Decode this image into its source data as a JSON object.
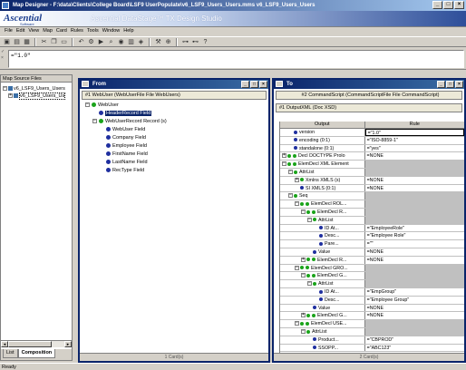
{
  "window": {
    "title": "Map Designer - F:\\data\\Clients\\College Board\\LSF9 UserPopulate\\v6_LSF9_Users_Users.mms v6_LSF9_Users_Users",
    "min": "_",
    "max": "□",
    "close": "×"
  },
  "banner": {
    "logo": "Ascential",
    "logo_sub": "Software",
    "studio": "Ascential DataStage™ TX Design Studio"
  },
  "menu": [
    "File",
    "Edit",
    "View",
    "Map",
    "Card",
    "Rules",
    "Tools",
    "Window",
    "Help"
  ],
  "toolbar_icons": [
    "new-icon",
    "open-icon",
    "save-icon",
    "cut-icon",
    "copy-icon",
    "paste-icon",
    "undo-icon",
    "build-icon",
    "run-icon",
    "find-icon",
    "trace-icon",
    "cards-icon",
    "compose-icon",
    "tool-icon",
    "zoom-icon",
    "help-icon"
  ],
  "rule_bar": {
    "value": "=\"1.0\""
  },
  "left_pane": {
    "header": "Map Source Files",
    "items": [
      {
        "label": "v6_LSF9_Users_Users",
        "level": 0
      },
      {
        "label": "v6_LSF9_Users_Us",
        "level": 1
      }
    ],
    "tabs": [
      {
        "label": "List",
        "active": false
      },
      {
        "label": "Composition",
        "active": true
      }
    ]
  },
  "from_pane": {
    "title": "From",
    "card_header": "#1 WebUser (WebUserFile File WebUsers)",
    "footer": "1 Card(s)",
    "nodes": [
      {
        "label": "WebUser",
        "level": 0,
        "expander": "−",
        "dot": "green",
        "selected": false
      },
      {
        "label": "HeaderRecord Field",
        "level": 1,
        "expander": "",
        "dot": "blue",
        "selected": true
      },
      {
        "label": "WebUserRecord Record (s)",
        "level": 1,
        "expander": "−",
        "dot": "green",
        "selected": false
      },
      {
        "label": "WebUser Field",
        "level": 2,
        "expander": "",
        "dot": "blue",
        "selected": false
      },
      {
        "label": "Company Field",
        "level": 2,
        "expander": "",
        "dot": "blue",
        "selected": false
      },
      {
        "label": "Employee Field",
        "level": 2,
        "expander": "",
        "dot": "blue",
        "selected": false
      },
      {
        "label": "FirstName Field",
        "level": 2,
        "expander": "",
        "dot": "blue",
        "selected": false
      },
      {
        "label": "LastName Field",
        "level": 2,
        "expander": "",
        "dot": "blue",
        "selected": false
      },
      {
        "label": "RecType Field",
        "level": 2,
        "expander": "",
        "dot": "blue",
        "selected": false
      }
    ]
  },
  "to_pane": {
    "title": "To",
    "card_header_1": "#2 CommandScript (CommandScriptFile File CommandScript)",
    "card_header_2": "#1 OutputXML (Doc XSD)",
    "col_output": "Output",
    "col_rule": "Rule",
    "footer": "2 Card(s)",
    "rows": [
      {
        "label": "version",
        "level": 1,
        "exp": "",
        "dots": "b",
        "rule": "=\"1.0\"",
        "gray": false,
        "edit": true
      },
      {
        "label": "encoding (0:1)",
        "level": 1,
        "exp": "",
        "dots": "b",
        "rule": "=\"ISO-8859-1\"",
        "gray": false,
        "edit": false
      },
      {
        "label": "standalone (0:1)",
        "level": 1,
        "exp": "",
        "dots": "b",
        "rule": "=\"yes\"",
        "gray": false,
        "edit": false
      },
      {
        "label": "Decl DOCTYPE Prolo",
        "level": 0,
        "exp": "+",
        "dots": "gg",
        "rule": "=NONE",
        "gray": false,
        "edit": false
      },
      {
        "label": "ElemDecl XML Element",
        "level": 0,
        "exp": "−",
        "dots": "gg",
        "rule": "",
        "gray": true,
        "edit": false
      },
      {
        "label": "AttrList",
        "level": 1,
        "exp": "−",
        "dots": "g",
        "rule": "",
        "gray": true,
        "edit": false
      },
      {
        "label": "Xmlns XMLS (s)",
        "level": 2,
        "exp": "+",
        "dots": "g",
        "rule": "=NONE",
        "gray": false,
        "edit": false
      },
      {
        "label": "SI XMLS (0:1)",
        "level": 2,
        "exp": "",
        "dots": "b",
        "rule": "=NONE",
        "gray": false,
        "edit": false
      },
      {
        "label": "Seq",
        "level": 1,
        "exp": "−",
        "dots": "g",
        "rule": "",
        "gray": true,
        "edit": false
      },
      {
        "label": "ElemDecl ROL...",
        "level": 2,
        "exp": "−",
        "dots": "gg",
        "rule": "",
        "gray": true,
        "edit": false
      },
      {
        "label": "ElemDecl R...",
        "level": 3,
        "exp": "−",
        "dots": "gg",
        "rule": "",
        "gray": true,
        "edit": false
      },
      {
        "label": "AttrList",
        "level": 4,
        "exp": "−",
        "dots": "g",
        "rule": "",
        "gray": true,
        "edit": false
      },
      {
        "label": "ID At...",
        "level": 5,
        "exp": "",
        "dots": "b",
        "rule": "=\"EmployeeRole\"",
        "gray": false,
        "edit": false
      },
      {
        "label": "Desc...",
        "level": 5,
        "exp": "",
        "dots": "b",
        "rule": "=\"Employee Role\"",
        "gray": false,
        "edit": false
      },
      {
        "label": "Pare...",
        "level": 5,
        "exp": "",
        "dots": "b",
        "rule": "=\"\"",
        "gray": false,
        "edit": false
      },
      {
        "label": "Value",
        "level": 4,
        "exp": "",
        "dots": "b",
        "rule": "=NONE",
        "gray": false,
        "edit": false
      },
      {
        "label": "ElemDecl R...",
        "level": 3,
        "exp": "+",
        "dots": "gg",
        "rule": "=NONE",
        "gray": false,
        "edit": false
      },
      {
        "label": "ElemDecl GRO...",
        "level": 2,
        "exp": "−",
        "dots": "gg",
        "rule": "",
        "gray": true,
        "edit": false
      },
      {
        "label": "ElemDecl G...",
        "level": 3,
        "exp": "−",
        "dots": "gg",
        "rule": "",
        "gray": true,
        "edit": false
      },
      {
        "label": "AttrList",
        "level": 4,
        "exp": "−",
        "dots": "g",
        "rule": "",
        "gray": true,
        "edit": false
      },
      {
        "label": "ID At...",
        "level": 5,
        "exp": "",
        "dots": "b",
        "rule": "=\"EmpGroup\"",
        "gray": false,
        "edit": false
      },
      {
        "label": "Desc...",
        "level": 5,
        "exp": "",
        "dots": "b",
        "rule": "=\"Employee Group\"",
        "gray": false,
        "edit": false
      },
      {
        "label": "Value",
        "level": 4,
        "exp": "",
        "dots": "b",
        "rule": "=NONE",
        "gray": false,
        "edit": false
      },
      {
        "label": "ElemDecl G...",
        "level": 3,
        "exp": "+",
        "dots": "gg",
        "rule": "=NONE",
        "gray": false,
        "edit": false
      },
      {
        "label": "ElemDecl USE...",
        "level": 2,
        "exp": "−",
        "dots": "gg",
        "rule": "",
        "gray": true,
        "edit": false
      },
      {
        "label": "AttrList",
        "level": 3,
        "exp": "−",
        "dots": "g",
        "rule": "",
        "gray": true,
        "edit": false
      },
      {
        "label": "Product...",
        "level": 4,
        "exp": "",
        "dots": "b",
        "rule": "=\"CBPROD\"",
        "gray": false,
        "edit": false
      },
      {
        "label": "SSOPP...",
        "level": 4,
        "exp": "",
        "dots": "b",
        "rule": "=\"ABC123\"",
        "gray": false,
        "edit": false
      }
    ]
  },
  "status": {
    "text": "Ready"
  }
}
